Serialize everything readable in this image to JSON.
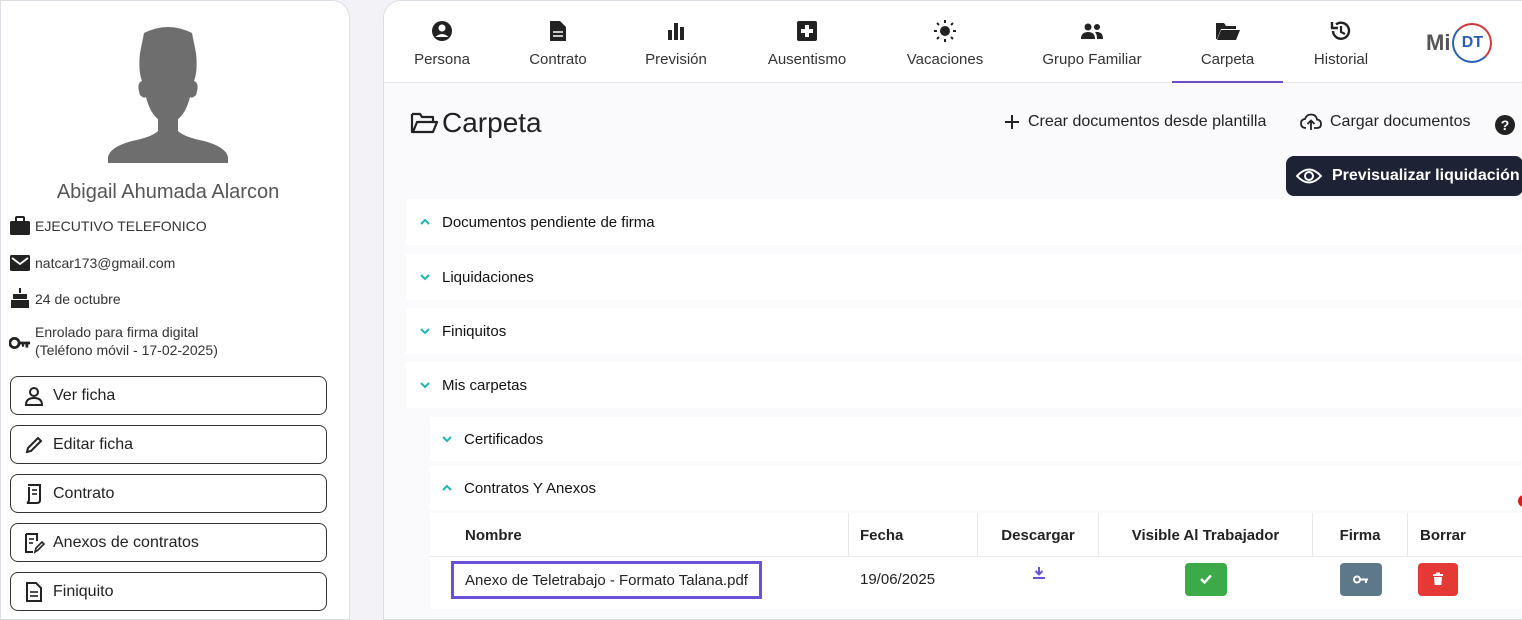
{
  "profile": {
    "name": "Abigail Ahumada Alarcon",
    "position": "EJECUTIVO TELEFONICO",
    "email": "natcar173@gmail.com",
    "birthday": "24 de octubre",
    "signature_line1": "Enrolado para firma digital",
    "signature_line2": "(Teléfono móvil - 17-02-2025)"
  },
  "sidebar_buttons": {
    "ver_ficha": "Ver ficha",
    "editar_ficha": "Editar ficha",
    "contrato": "Contrato",
    "anexos": "Anexos de contratos",
    "finiquito": "Finiquito"
  },
  "tabs": {
    "persona": "Persona",
    "contrato": "Contrato",
    "prevision": "Previsión",
    "ausentismo": "Ausentismo",
    "vacaciones": "Vacaciones",
    "grupo_familiar": "Grupo Familiar",
    "carpeta": "Carpeta",
    "historial": "Historial",
    "active": "Carpeta"
  },
  "logo": {
    "mi": "Mi",
    "dt": "DT"
  },
  "page": {
    "title": "Carpeta",
    "create_docs": "Crear documentos desde plantilla",
    "upload_docs": "Cargar documentos",
    "help": "?",
    "preview_button": "Previsualizar liquidación"
  },
  "sections": {
    "pending": "Documentos pendiente de firma",
    "liquidaciones": "Liquidaciones",
    "finiquitos": "Finiquitos",
    "mis_carpetas": "Mis carpetas",
    "certificados": "Certificados",
    "contratos_anexos": "Contratos Y Anexos"
  },
  "table": {
    "headers": {
      "nombre": "Nombre",
      "fecha": "Fecha",
      "descargar": "Descargar",
      "visible": "Visible Al Trabajador",
      "firma": "Firma",
      "borrar": "Borrar"
    },
    "rows": [
      {
        "nombre": "Anexo de Teletrabajo - Formato Talana.pdf",
        "fecha": "19/06/2025"
      }
    ]
  },
  "colors": {
    "accent": "#6c4ccc",
    "teal": "#1fb5b5",
    "dark_button": "#1e2235",
    "visible_green": "#3daa4a",
    "firma_gray": "#5d7888",
    "borrar_red": "#e53935"
  }
}
